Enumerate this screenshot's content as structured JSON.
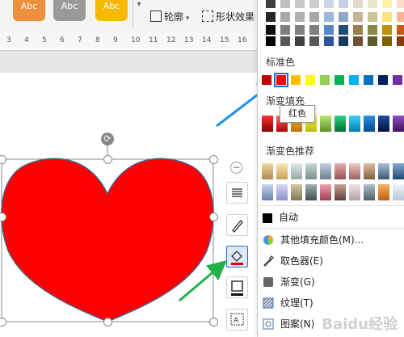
{
  "ribbon": {
    "styles": [
      {
        "label": "Abc",
        "color": "#ee8f3c"
      },
      {
        "label": "Abc",
        "color": "#9a9a9a"
      },
      {
        "label": "Abc",
        "color": "#f6b800"
      }
    ],
    "outline_label": "轮廓",
    "shape_effects_label": "形状效果"
  },
  "ruler": {
    "ticks": [
      "3",
      "4",
      "5",
      "6",
      "7",
      "8",
      "9",
      "10",
      "11",
      "12",
      "13",
      "14",
      "15",
      "16"
    ]
  },
  "colors": {
    "top_grid": [
      [
        "#3f3f3f",
        "#c0c0c0",
        "#c8c8c8",
        "#cccccc",
        "#c9d7e9",
        "#c5d2e4",
        "#e3d7c9",
        "#e6e6c9",
        "#fff1a8",
        "#ffd9c9"
      ],
      [
        "#262626",
        "#a8a8a8",
        "#b0b0b0",
        "#a6a6a6",
        "#9ab6dc",
        "#8ea8cc",
        "#c8b495",
        "#c6c69a",
        "#ffe57a",
        "#ffb491"
      ],
      [
        "#0d0d0d",
        "#7f7f7f",
        "#808080",
        "#7f7f7f",
        "#5b86c5",
        "#1f4e79",
        "#9c7f4f",
        "#8a8a48",
        "#c09100",
        "#c55a11"
      ],
      [
        "#000000",
        "#595959",
        "#3f3f3f",
        "#595959",
        "#2e5597",
        "#163a5c",
        "#6a5434",
        "#5c5c2f",
        "#7f6000",
        "#833c0b"
      ]
    ],
    "standard": [
      "#c00000",
      "#ff0000",
      "#ffc000",
      "#ffff00",
      "#92d050",
      "#00b050",
      "#00b0f0",
      "#0070c0",
      "#002060",
      "#7030a0"
    ],
    "gradient_fill": [
      [
        "#8b0000",
        "#ff3030"
      ],
      [
        "#b00000",
        "#ff6a6a"
      ],
      [
        "#c07000",
        "#ffc040"
      ],
      [
        "#b8b800",
        "#ffff60"
      ],
      [
        "#5a9020",
        "#b8e878"
      ],
      [
        "#007030",
        "#30d080"
      ],
      [
        "#0080b0",
        "#40d0ff"
      ],
      [
        "#004a90",
        "#3090e0"
      ],
      [
        "#001040",
        "#2050a0"
      ],
      [
        "#401060",
        "#9050c0"
      ]
    ],
    "gradient_recommend": [
      [
        [
          "#b08a4a",
          "#f0d8a0"
        ],
        [
          "#c8a050",
          "#f8e8b8"
        ],
        [
          "#98a8a8",
          "#e0e8e8"
        ],
        [
          "#7a9090",
          "#c8d8d8"
        ],
        [
          "#708090",
          "#c0d0e0"
        ],
        [
          "#985050",
          "#e8b0b0"
        ],
        [
          "#a06060",
          "#f0c8c8"
        ],
        [
          "#806040",
          "#e0c0a0"
        ],
        [
          "#405878",
          "#a8c0d8"
        ],
        [
          "#204870",
          "#80a8d0"
        ]
      ],
      [
        [
          "#6880a8",
          "#c8d8f0"
        ],
        [
          "#8890c8",
          "#d8d8f8"
        ],
        [
          "#807858",
          "#d0c8a0"
        ],
        [
          "#405050",
          "#a0b0b0"
        ],
        [
          "#a04050",
          "#f0a0b0"
        ],
        [
          "#604038",
          "#c8a090"
        ],
        [
          "#b8a0a8",
          "#f0e0e8"
        ],
        [
          "#506068",
          "#b0c0c8"
        ],
        [
          "#c06010",
          "#f8b060"
        ],
        [
          "#b8c8d8",
          "#f0f4f8"
        ]
      ]
    ],
    "accents": {
      "selection": "#1f6fd1",
      "arrow_blue": "#1e90e8",
      "arrow_green": "#22b04a",
      "heart": "#ff0000"
    }
  },
  "panel": {
    "standard_title": "标准色",
    "gradient_fill_title": "渐变填充",
    "gradient_recommend_title": "渐变色推荐",
    "auto_label": "自动",
    "tooltip": "红色",
    "menu": [
      {
        "label": "其他填充颜色(M)...",
        "icon": "color-wheel-icon"
      },
      {
        "label": "取色器(E)",
        "icon": "eyedropper-icon"
      },
      {
        "label": "渐变(G)",
        "icon": "gradient-icon"
      },
      {
        "label": "纹理(T)",
        "icon": "texture-icon"
      },
      {
        "label": "图案(N)",
        "icon": "pattern-icon"
      }
    ]
  },
  "watermark": "Baidu经验"
}
